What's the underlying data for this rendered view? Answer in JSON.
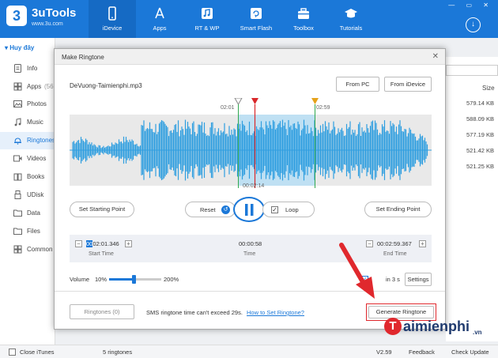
{
  "app": {
    "name": "3uTools",
    "url": "www.3u.com",
    "logo_char": "3"
  },
  "nav": [
    {
      "label": "iDevice",
      "icon": "phone-icon"
    },
    {
      "label": "Apps",
      "icon": "app-store-icon"
    },
    {
      "label": "RT & WP",
      "icon": "music-note-icon"
    },
    {
      "label": "Smart Flash",
      "icon": "flash-icon"
    },
    {
      "label": "Toolbox",
      "icon": "toolbox-icon"
    },
    {
      "label": "Tutorials",
      "icon": "graduation-cap-icon"
    }
  ],
  "sidebar": {
    "device": "Huy đây",
    "items": [
      {
        "label": "Info",
        "icon": "info-icon"
      },
      {
        "label": "Apps",
        "badge": "(56",
        "icon": "apps-icon"
      },
      {
        "label": "Photos",
        "icon": "photos-icon"
      },
      {
        "label": "Music",
        "icon": "music-icon"
      },
      {
        "label": "Ringtones",
        "icon": "bell-icon"
      },
      {
        "label": "Videos",
        "icon": "video-icon"
      },
      {
        "label": "Books",
        "icon": "book-icon"
      },
      {
        "label": "UDisk",
        "icon": "udisk-icon"
      },
      {
        "label": "Data",
        "icon": "folder-icon"
      },
      {
        "label": "Files",
        "icon": "file-icon"
      },
      {
        "label": "Common",
        "icon": "grid-icon"
      }
    ]
  },
  "list": {
    "size_header": "Size",
    "sizes": [
      "579.14 KB",
      "588.09 KB",
      "577.19 KB",
      "521.42 KB",
      "521.25 KB"
    ]
  },
  "dialog": {
    "title": "Make Ringtone",
    "filename": "DeVuong-Taimienphi.mp3",
    "from_pc": "From PC",
    "from_idevice": "From iDevice",
    "marker_start_time": "02:01",
    "marker_end_time": "02:59",
    "playhead_time": "00:02:14",
    "set_start": "Set Starting Point",
    "set_end": "Set Ending Point",
    "reset": "Reset",
    "loop": "Loop",
    "start_time": "02:01.346",
    "start_time_prefix": "00",
    "start_label": "Start Time",
    "duration": "00:00:58",
    "time_label": "Time",
    "end_time": "00:02:59.367",
    "end_label": "End Time",
    "volume_label": "Volume",
    "volume_min": "10%",
    "volume_max": "200%",
    "fade_label": "in 3 s",
    "settings": "Settings",
    "ringtones_btn": "Ringtones (0)",
    "sms_note": "SMS ringtone time can't exceed 29s.",
    "how_to": "How to Set Ringtone?",
    "generate": "Generate Ringtone"
  },
  "status": {
    "close_itunes": "Close iTunes",
    "count": "5 ringtones",
    "version": "V2.59",
    "feedback": "Feedback",
    "check_update": "Check Update"
  },
  "watermark": {
    "text": "aimienphi",
    "suffix": ".vn"
  },
  "colors": {
    "brand": "#1b78d8",
    "wave": "#2f9ee0",
    "selection": "#bfe0f3",
    "start_marker": "#9b9b9b",
    "playhead": "#d9282a",
    "end_marker": "#e5a21b",
    "arrow": "#e0282d"
  }
}
